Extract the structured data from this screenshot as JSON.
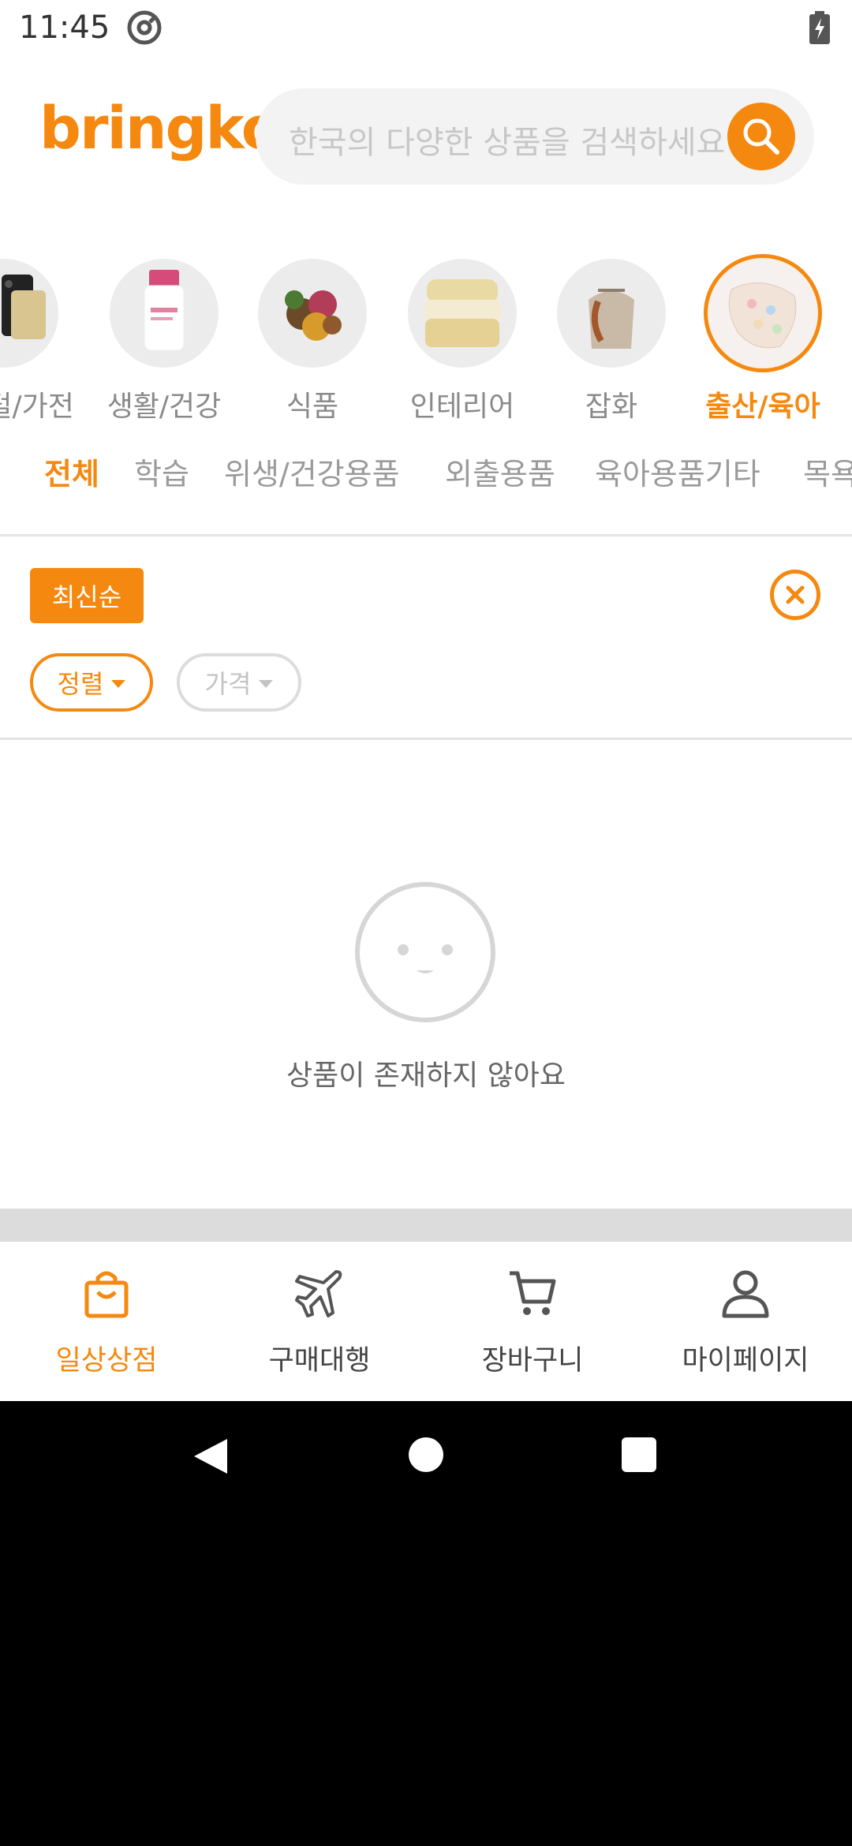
{
  "status_bar": {
    "time": "11:45",
    "icons": [
      "at-sign-icon",
      "battery-charging-icon"
    ]
  },
  "header": {
    "logo": "bringko",
    "search": {
      "placeholder": "한국의 다양한 상품을 검색하세요",
      "button_icon": "search-icon"
    }
  },
  "categories": [
    {
      "label": "디지털/가전",
      "icon": "phone-device-icon"
    },
    {
      "label": "생활/건강",
      "icon": "supplement-bottle-icon"
    },
    {
      "label": "식품",
      "icon": "food-icon"
    },
    {
      "label": "인테리어",
      "icon": "bedding-icon"
    },
    {
      "label": "잡화",
      "icon": "bag-icon"
    },
    {
      "label": "출산/육아",
      "icon": "baby-item-icon",
      "active": true
    }
  ],
  "sub_tabs": [
    "전체",
    "학습",
    "위생/건강용품",
    "외출용품",
    "육아용품기타",
    "목욕"
  ],
  "filters": {
    "applied_chip": "최신순",
    "clear_icon": "close-circle-icon",
    "sort_label": "정렬",
    "price_label": "가격"
  },
  "empty_state": {
    "icon": "sad-face-icon",
    "message": "상품이 존재하지 않아요"
  },
  "bottom_nav": [
    {
      "label": "일상상점",
      "icon": "shopping-bag-icon",
      "active": true
    },
    {
      "label": "구매대행",
      "icon": "airplane-icon"
    },
    {
      "label": "장바구니",
      "icon": "cart-icon"
    },
    {
      "label": "마이페이지",
      "icon": "person-icon"
    }
  ],
  "colors": {
    "accent": "#f5890f",
    "muted": "#9a9a9a",
    "divider": "#e3e3e3"
  }
}
